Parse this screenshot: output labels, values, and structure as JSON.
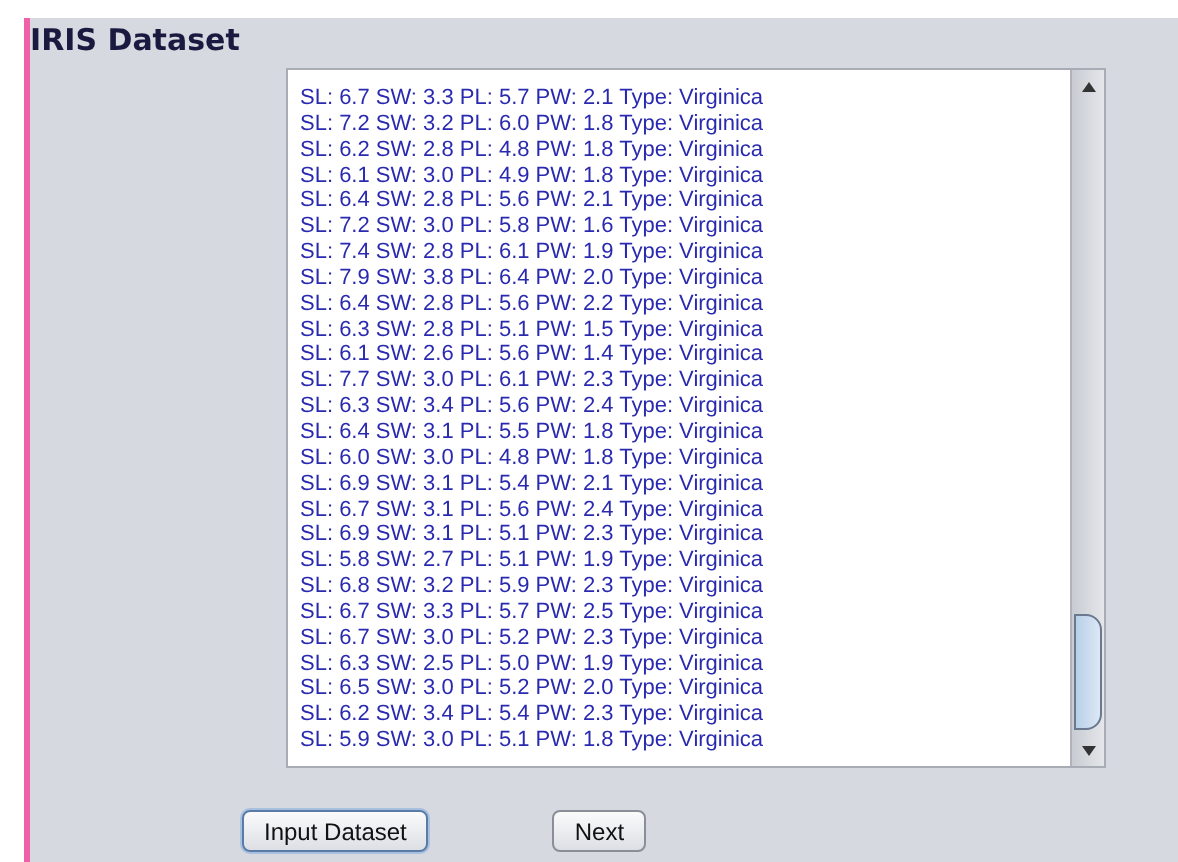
{
  "window": {
    "title": "IRIS Dataset"
  },
  "records": [
    "SL: 6.7 SW: 3.3 PL: 5.7 PW: 2.1 Type: Virginica",
    "SL: 7.2 SW: 3.2 PL: 6.0 PW: 1.8 Type: Virginica",
    "SL: 6.2 SW: 2.8 PL: 4.8 PW: 1.8 Type: Virginica",
    "SL: 6.1 SW: 3.0 PL: 4.9 PW: 1.8 Type: Virginica",
    "SL: 6.4 SW: 2.8 PL: 5.6 PW: 2.1 Type: Virginica",
    "SL: 7.2 SW: 3.0 PL: 5.8 PW: 1.6 Type: Virginica",
    "SL: 7.4 SW: 2.8 PL: 6.1 PW: 1.9 Type: Virginica",
    "SL: 7.9 SW: 3.8 PL: 6.4 PW: 2.0 Type: Virginica",
    "SL: 6.4 SW: 2.8 PL: 5.6 PW: 2.2 Type: Virginica",
    "SL: 6.3 SW: 2.8 PL: 5.1 PW: 1.5 Type: Virginica",
    "SL: 6.1 SW: 2.6 PL: 5.6 PW: 1.4 Type: Virginica",
    "SL: 7.7 SW: 3.0 PL: 6.1 PW: 2.3 Type: Virginica",
    "SL: 6.3 SW: 3.4 PL: 5.6 PW: 2.4 Type: Virginica",
    "SL: 6.4 SW: 3.1 PL: 5.5 PW: 1.8 Type: Virginica",
    "SL: 6.0 SW: 3.0 PL: 4.8 PW: 1.8 Type: Virginica",
    "SL: 6.9 SW: 3.1 PL: 5.4 PW: 2.1 Type: Virginica",
    "SL: 6.7 SW: 3.1 PL: 5.6 PW: 2.4 Type: Virginica",
    "SL: 6.9 SW: 3.1 PL: 5.1 PW: 2.3 Type: Virginica",
    "SL: 5.8 SW: 2.7 PL: 5.1 PW: 1.9 Type: Virginica",
    "SL: 6.8 SW: 3.2 PL: 5.9 PW: 2.3 Type: Virginica",
    "SL: 6.7 SW: 3.3 PL: 5.7 PW: 2.5 Type: Virginica",
    "SL: 6.7 SW: 3.0 PL: 5.2 PW: 2.3 Type: Virginica",
    "SL: 6.3 SW: 2.5 PL: 5.0 PW: 1.9 Type: Virginica",
    "SL: 6.5 SW: 3.0 PL: 5.2 PW: 2.0 Type: Virginica",
    "SL: 6.2 SW: 3.4 PL: 5.4 PW: 2.3 Type: Virginica",
    "SL: 5.9 SW: 3.0 PL: 5.1 PW: 1.8 Type: Virginica"
  ],
  "buttons": [
    {
      "label": "Input Dataset",
      "selected": true
    },
    {
      "label": "Next",
      "selected": false
    }
  ]
}
